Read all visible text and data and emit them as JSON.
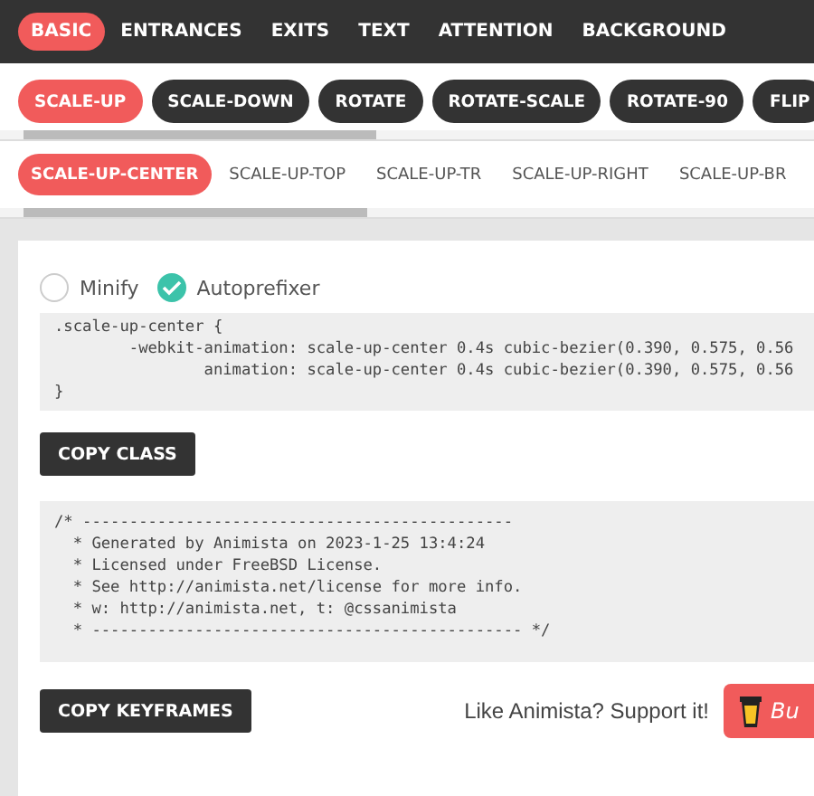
{
  "categories": [
    {
      "label": "BASIC",
      "selected": true
    },
    {
      "label": "ENTRANCES",
      "selected": false
    },
    {
      "label": "EXITS",
      "selected": false
    },
    {
      "label": "TEXT",
      "selected": false
    },
    {
      "label": "ATTENTION",
      "selected": false
    },
    {
      "label": "BACKGROUND",
      "selected": false
    }
  ],
  "groups": [
    {
      "label": "SCALE-UP",
      "selected": true
    },
    {
      "label": "SCALE-DOWN",
      "selected": false
    },
    {
      "label": "ROTATE",
      "selected": false
    },
    {
      "label": "ROTATE-SCALE",
      "selected": false
    },
    {
      "label": "ROTATE-90",
      "selected": false
    },
    {
      "label": "FLIP",
      "selected": false
    }
  ],
  "variants": [
    {
      "label": "SCALE-UP-CENTER",
      "selected": true
    },
    {
      "label": "SCALE-UP-TOP",
      "selected": false
    },
    {
      "label": "SCALE-UP-TR",
      "selected": false
    },
    {
      "label": "SCALE-UP-RIGHT",
      "selected": false
    },
    {
      "label": "SCALE-UP-BR",
      "selected": false
    }
  ],
  "options": [
    {
      "label": "Minify",
      "checked": false
    },
    {
      "label": "Autoprefixer",
      "checked": true
    }
  ],
  "class_code": [
    ".scale-up-center {",
    "        -webkit-animation: scale-up-center 0.4s cubic-bezier(0.390, 0.575, 0.56",
    "                animation: scale-up-center 0.4s cubic-bezier(0.390, 0.575, 0.56",
    "}"
  ],
  "copy_class": "COPY CLASS",
  "keyframes_code": [
    "/* ----------------------------------------------",
    "  * Generated by Animista on 2023-1-25 13:4:24",
    "  * Licensed under FreeBSD License.",
    "  * See http://animista.net/license for more info.",
    "  * w: http://animista.net, t: @cssanimista",
    "  * ---------------------------------------------- */"
  ],
  "copy_keyframes": "COPY KEYFRAMES",
  "support_text": "Like Animista? Support it!",
  "buy_button": "Bu"
}
